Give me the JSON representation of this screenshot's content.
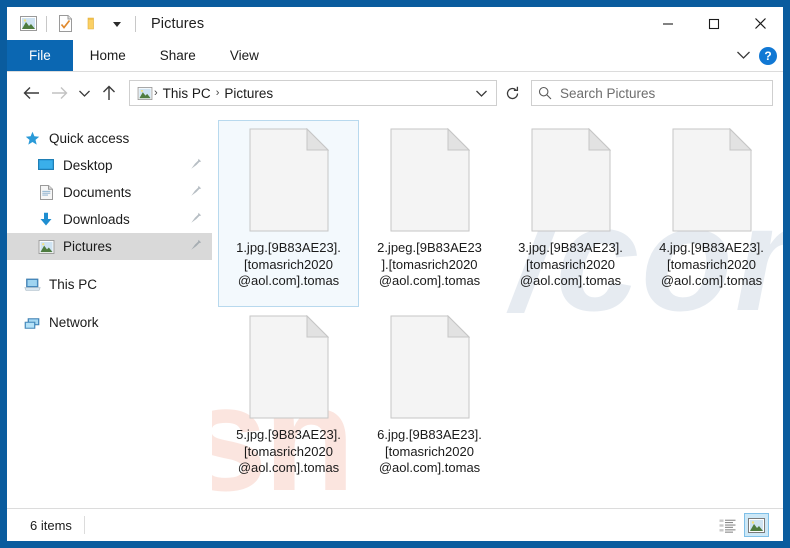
{
  "window": {
    "title": "Pictures",
    "frame_color": "#0a5c9e",
    "quick_access": [
      {
        "name": "pictures-icon",
        "label": "Pictures"
      },
      {
        "name": "properties-icon",
        "label": "Properties"
      },
      {
        "name": "new-folder-icon",
        "label": "New folder"
      },
      {
        "name": "chevron-down-icon",
        "label": "Customize Quick Access Toolbar"
      }
    ],
    "controls": {
      "minimize": "─",
      "maximize": "☐",
      "close": "✕"
    }
  },
  "ribbon": {
    "tabs": [
      {
        "label": "File",
        "active": true
      },
      {
        "label": "Home",
        "active": false
      },
      {
        "label": "Share",
        "active": false
      },
      {
        "label": "View",
        "active": false
      }
    ],
    "expand_label": "⌄",
    "help_label": "?"
  },
  "addressbar": {
    "back_label": "←",
    "forward_label": "→",
    "recent_label": "∨",
    "up_label": "↑",
    "breadcrumbs": [
      "This PC",
      "Pictures"
    ],
    "separator": "›",
    "dropdown_label": "∨",
    "refresh_label": "↻"
  },
  "search": {
    "placeholder": "Search Pictures",
    "value": ""
  },
  "sidebar": {
    "items": [
      {
        "label": "Quick access",
        "icon": "star-icon",
        "level": 0,
        "pinned": false,
        "selected": false
      },
      {
        "label": "Desktop",
        "icon": "desktop-icon",
        "level": 1,
        "pinned": true,
        "selected": false
      },
      {
        "label": "Documents",
        "icon": "documents-icon",
        "level": 1,
        "pinned": true,
        "selected": false
      },
      {
        "label": "Downloads",
        "icon": "downloads-icon",
        "level": 1,
        "pinned": true,
        "selected": false
      },
      {
        "label": "Pictures",
        "icon": "pictures-icon",
        "level": 1,
        "pinned": true,
        "selected": true
      },
      {
        "label": "This PC",
        "icon": "this-pc-icon",
        "level": 0,
        "pinned": false,
        "selected": false
      },
      {
        "label": "Network",
        "icon": "network-icon",
        "level": 0,
        "pinned": false,
        "selected": false
      }
    ]
  },
  "files": [
    {
      "name": "1.jpg.[9B83AE23].\n[tomasrich2020\n@aol.com].tomas",
      "icon": "blank-file-icon",
      "selected": true
    },
    {
      "name": "2.jpeg.[9B83AE23\n].[tomasrich2020\n@aol.com].tomas",
      "icon": "blank-file-icon",
      "selected": false
    },
    {
      "name": "3.jpg.[9B83AE23].\n[tomasrich2020\n@aol.com].tomas",
      "icon": "blank-file-icon",
      "selected": false
    },
    {
      "name": "4.jpg.[9B83AE23].\n[tomasrich2020\n@aol.com].tomas",
      "icon": "blank-file-icon",
      "selected": false
    },
    {
      "name": "5.jpg.[9B83AE23].\n[tomasrich2020\n@aol.com].tomas",
      "icon": "blank-file-icon",
      "selected": false
    },
    {
      "name": "6.jpg.[9B83AE23].\n[tomasrich2020\n@aol.com].tomas",
      "icon": "blank-file-icon",
      "selected": false
    }
  ],
  "statusbar": {
    "item_count": "6 items",
    "views": [
      {
        "name": "details-view-button",
        "active": false
      },
      {
        "name": "large-icons-view-button",
        "active": true
      }
    ]
  },
  "watermark": {
    "text_back": "risn",
    "text_front": "/com"
  }
}
